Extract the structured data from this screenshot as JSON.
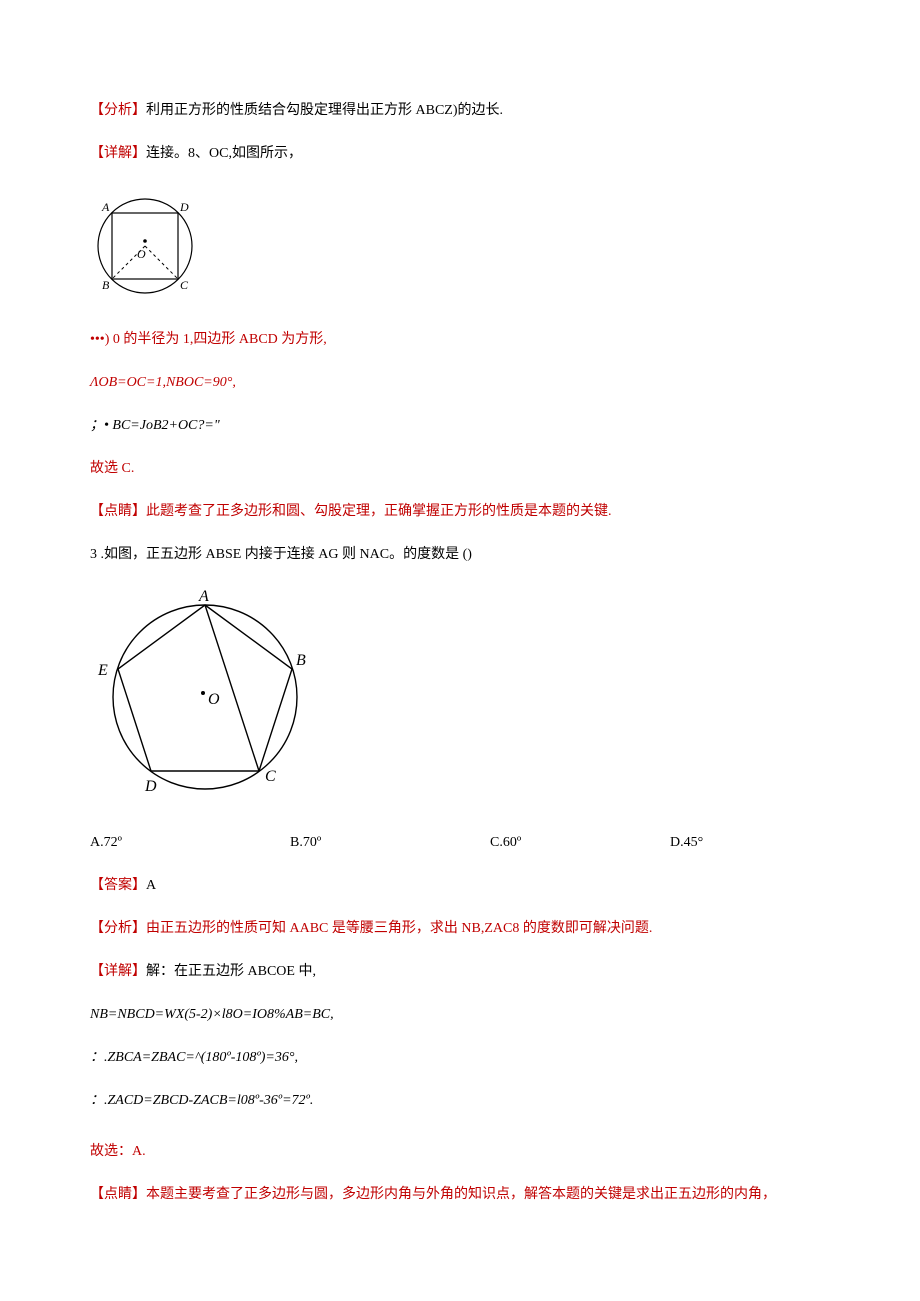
{
  "p1": {
    "analysis_tag": "【分析】",
    "analysis_text": "利用正方形的性质结合勾股定理得出正方形 ABCZ)的边长.",
    "detail_tag": "【详解】",
    "detail_text": "连接。8、OC,如图所示，",
    "step1_a": "•••) 0 的半径为 1,四边形 ABCD 为方形,",
    "step1_b": "ΛOB=OC=1,NBOC=90°,",
    "step1_c": "；• BC=JoB2+OC?=\"",
    "choose": "故选 C.",
    "note_tag": "【点睛】",
    "note_text": "此题考查了正多边形和圆、勾股定理，正确掌握正方形的性质是本题的关键."
  },
  "p2": {
    "q_num": "3",
    "q_text": " .如图，正五边形 ABSE 内接于连接 AG 则 NAC。的度数是 ()",
    "optA": "A.72º",
    "optB": "B.70º",
    "optC": "C.60º",
    "optD": "D.45°",
    "ans_tag": "【答案】",
    "ans_text": "A",
    "analysis_tag": "【分析】",
    "analysis_text": "由正五边形的性质可知 AABC 是等腰三角形，求出 NB,ZAC8 的度数即可解决问题.",
    "detail_tag": "【详解】",
    "detail_text": "解：在正五边形 ABCOE 中,",
    "s1": "NB=NBCD=WX(5-2)×l8O=IO8%AB=BC,",
    "s2": "：.ZBCA=ZBAC=^(180º-108º)=36°,",
    "s3": "：.ZACD=ZBCD-ZACB=l08º-36º=72º.",
    "choose": "故选：A.",
    "note_tag": "【点睛】",
    "note_text": "本题主要考查了正多边形与圆，多边形内角与外角的知识点，解答本题的关键是求出正五边形的内角，"
  }
}
